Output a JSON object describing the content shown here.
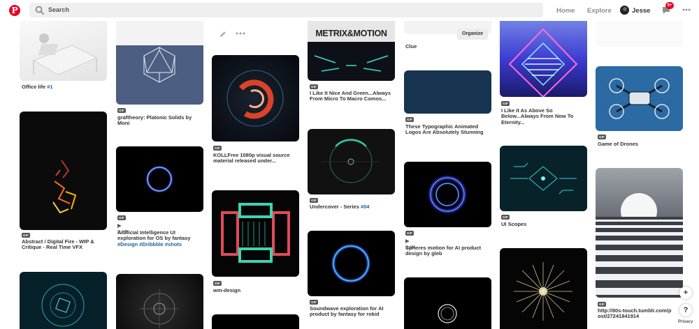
{
  "header": {
    "logo": "P",
    "search_placeholder": "Search",
    "nav_home": "Home",
    "nav_explore": "Explore",
    "user_name": "Jesse",
    "notifications_badge": "9+",
    "icons": [
      "pinterest-logo",
      "search-icon",
      "message-icon",
      "more-icon"
    ]
  },
  "board_tools": {
    "organize_label": "Organize"
  },
  "gif_label": "GIF",
  "pins": {
    "p1": {
      "title": "Office life ",
      "hashtag": "#1"
    },
    "p2": {
      "title": "Abstract / Digital Fire - WIP & Critique - Real Time VFX"
    },
    "p3": {
      "title": "graftheory: Platonic Solids by Moni"
    },
    "p4": {
      "duration": "0:05",
      "title": "Artificial Intelligence UI exploration for OS by fantasy ",
      "hashtag": "#Design #Dribbble #shots"
    },
    "p5": {
      "title": "KOLLFree 1080p visual source material released under..."
    },
    "p6": {
      "title": "wm-design"
    },
    "p7": {
      "brand_text": "METRIX&MOTION",
      "title": "I Like It Nice And Green...Always From Micro To Macro Comos..."
    },
    "p8": {
      "title": "Undercover - Series ",
      "hashtag": "#04"
    },
    "p9": {
      "title": "Soundwave exploration for AI product by fantasy for rokid"
    },
    "p10": {
      "title": "Clue"
    },
    "p11": {
      "title": "These Typographic Animated Logos Are Absolutely Stunning"
    },
    "p12": {
      "duration": "0:04",
      "title": "Spheres motion for AI product design by gleb"
    },
    "p13": {
      "title": "I Like It As Above So Below...Always From Now To Eternity..."
    },
    "p14": {
      "title": "UI Scopes"
    },
    "p15": {
      "title": "Game of Drones"
    },
    "p16": {
      "title": "http://80s-touch.tumblr.com/post/27241841914"
    }
  },
  "fab": {
    "add": "+",
    "help": "?",
    "privacy": "Privacy"
  },
  "colors": {
    "brand": "#e60023",
    "link": "#1e5e9a",
    "search_bg": "#efefef"
  }
}
